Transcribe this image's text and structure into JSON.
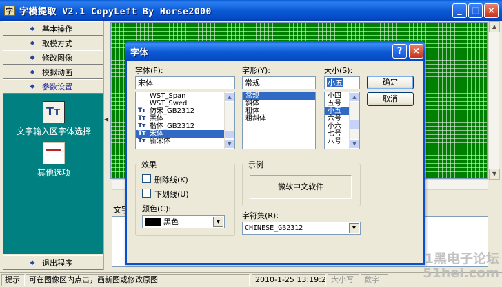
{
  "window": {
    "title": "字模提取 V2.1  CopyLeft By Horse2000",
    "minimize_glyph": "_",
    "maximize_glyph": "□",
    "close_glyph": "×"
  },
  "nav": {
    "items": [
      {
        "label": "基本操作"
      },
      {
        "label": "取模方式"
      },
      {
        "label": "修改图像"
      },
      {
        "label": "模拟动画"
      },
      {
        "label": "参数设置"
      }
    ],
    "exit_label": "退出程序",
    "arrow_glyph": "◆"
  },
  "tools": {
    "text_input": "文字输入区字体选择",
    "other_options": "其他选项"
  },
  "lower": {
    "label": "文字"
  },
  "status": {
    "hint_label": "提示",
    "message": "可在图像区内点击，画新图或修改原图",
    "datetime": "2010-1-25 13:19:29",
    "capslock": "大小写",
    "numlock": "数字"
  },
  "watermark": {
    "line1": "51黑电子论坛",
    "line2": "51hei.com"
  },
  "dialog": {
    "title": "字体",
    "help_glyph": "?",
    "close_glyph": "×",
    "font_label": "字体(F):",
    "font_value": "宋体",
    "font_list": [
      {
        "name": "WST_Span",
        "icon": ""
      },
      {
        "name": "WST_Swed",
        "icon": ""
      },
      {
        "name": "仿宋_GB2312",
        "icon": "Tт"
      },
      {
        "name": "黑体",
        "icon": "Tт"
      },
      {
        "name": "楷体_GB2312",
        "icon": "Tт"
      },
      {
        "name": "宋体",
        "icon": "Tт",
        "selected": true
      },
      {
        "name": "新宋体",
        "icon": "Tт"
      }
    ],
    "style_label": "字形(Y):",
    "style_value": "常规",
    "style_list": [
      {
        "name": "常规",
        "selected": true
      },
      {
        "name": "斜体"
      },
      {
        "name": "粗体"
      },
      {
        "name": "粗斜体"
      }
    ],
    "size_label": "大小(S):",
    "size_value": "小五",
    "size_list": [
      {
        "name": "小四"
      },
      {
        "name": "五号"
      },
      {
        "name": "小五",
        "selected": true
      },
      {
        "name": "六号"
      },
      {
        "name": "小六"
      },
      {
        "name": "七号"
      },
      {
        "name": "八号"
      }
    ],
    "ok_label": "确定",
    "cancel_label": "取消",
    "effects_label": "效果",
    "strikeout_label": "删除线(K)",
    "underline_label": "下划线(U)",
    "color_label": "颜色(C):",
    "color_value": "黑色",
    "color_swatch": "#000000",
    "sample_label": "示例",
    "sample_text": "微软中文软件",
    "charset_label": "字符集(R):",
    "charset_value": "CHINESE_GB2312"
  }
}
